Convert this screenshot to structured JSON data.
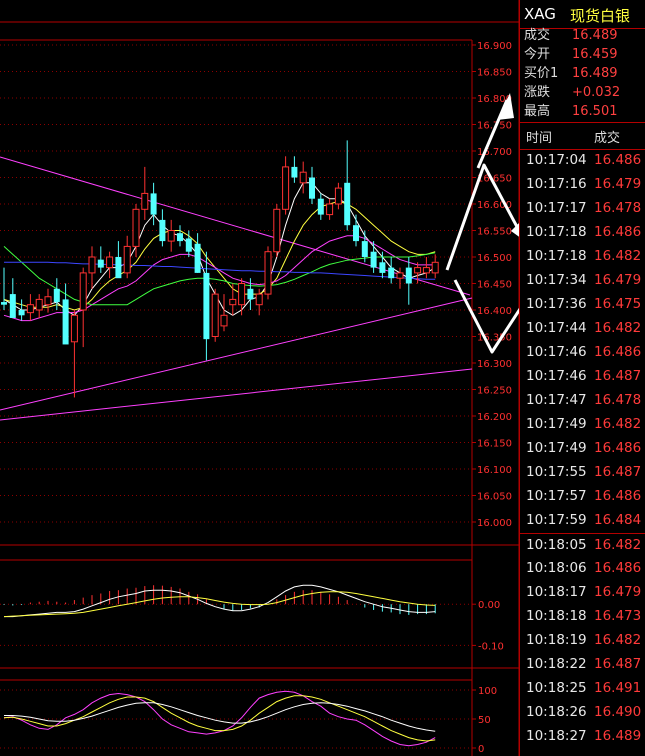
{
  "header": {
    "symbol": "XAG",
    "name": "现货白银"
  },
  "quote": [
    {
      "label": "成交",
      "value": "16.489"
    },
    {
      "label": "今开",
      "value": "16.459"
    },
    {
      "label": "买价1",
      "value": "16.489"
    },
    {
      "label": "涨跌",
      "value": "+0.032"
    },
    {
      "label": "最高",
      "value": "16.501"
    }
  ],
  "ticks_header": {
    "time": "时间",
    "price": "成交"
  },
  "ticks": [
    {
      "time": "10:17:04",
      "price": "16.486"
    },
    {
      "time": "10:17:16",
      "price": "16.479"
    },
    {
      "time": "10:17:17",
      "price": "16.478"
    },
    {
      "time": "10:17:18",
      "price": "16.486"
    },
    {
      "time": "10:17:18",
      "price": "16.482"
    },
    {
      "time": "10:17:34",
      "price": "16.479"
    },
    {
      "time": "10:17:36",
      "price": "16.475"
    },
    {
      "time": "10:17:44",
      "price": "16.482"
    },
    {
      "time": "10:17:46",
      "price": "16.486"
    },
    {
      "time": "10:17:46",
      "price": "16.487"
    },
    {
      "time": "10:17:47",
      "price": "16.478"
    },
    {
      "time": "10:17:49",
      "price": "16.482"
    },
    {
      "time": "10:17:49",
      "price": "16.486"
    },
    {
      "time": "10:17:55",
      "price": "16.487"
    },
    {
      "time": "10:17:57",
      "price": "16.486"
    },
    {
      "time": "10:17:59",
      "price": "16.484"
    },
    {
      "time": "10:18:05",
      "price": "16.482"
    },
    {
      "time": "10:18:06",
      "price": "16.486"
    },
    {
      "time": "10:18:17",
      "price": "16.479"
    },
    {
      "time": "10:18:18",
      "price": "16.473"
    },
    {
      "time": "10:18:19",
      "price": "16.482"
    },
    {
      "time": "10:18:22",
      "price": "16.487"
    },
    {
      "time": "10:18:25",
      "price": "16.491"
    },
    {
      "time": "10:18:26",
      "price": "16.490"
    },
    {
      "time": "10:18:27",
      "price": "16.489"
    }
  ],
  "colors": {
    "up": "#ff3232",
    "down": "#54ffff",
    "grid": "#8c0000",
    "frame": "#b40000"
  },
  "chart_data": [
    {
      "type": "candlestick",
      "ylim": [
        16.0,
        16.9
      ],
      "y_ticks": [
        "16.900",
        "16.850",
        "16.800",
        "16.750",
        "16.700",
        "16.650",
        "16.600",
        "16.550",
        "16.500",
        "16.450",
        "16.400",
        "16.350",
        "16.300",
        "16.250",
        "16.200",
        "16.150",
        "16.100",
        "16.050",
        "16.000"
      ],
      "candles": [
        {
          "o": 16.415,
          "h": 16.48,
          "l": 16.4,
          "c": 16.41
        },
        {
          "o": 16.43,
          "h": 16.46,
          "l": 16.395,
          "c": 16.385
        },
        {
          "o": 16.4,
          "h": 16.42,
          "l": 16.38,
          "c": 16.39
        },
        {
          "o": 16.395,
          "h": 16.43,
          "l": 16.38,
          "c": 16.41
        },
        {
          "o": 16.4,
          "h": 16.43,
          "l": 16.385,
          "c": 16.42
        },
        {
          "o": 16.41,
          "h": 16.44,
          "l": 16.395,
          "c": 16.425
        },
        {
          "o": 16.44,
          "h": 16.46,
          "l": 16.4,
          "c": 16.415
        },
        {
          "o": 16.42,
          "h": 16.45,
          "l": 16.34,
          "c": 16.335
        },
        {
          "o": 16.34,
          "h": 16.4,
          "l": 16.235,
          "c": 16.39
        },
        {
          "o": 16.4,
          "h": 16.48,
          "l": 16.33,
          "c": 16.47
        },
        {
          "o": 16.47,
          "h": 16.52,
          "l": 16.44,
          "c": 16.5
        },
        {
          "o": 16.495,
          "h": 16.52,
          "l": 16.47,
          "c": 16.48
        },
        {
          "o": 16.48,
          "h": 16.51,
          "l": 16.46,
          "c": 16.5
        },
        {
          "o": 16.5,
          "h": 16.53,
          "l": 16.47,
          "c": 16.46
        },
        {
          "o": 16.47,
          "h": 16.54,
          "l": 16.46,
          "c": 16.52
        },
        {
          "o": 16.52,
          "h": 16.6,
          "l": 16.5,
          "c": 16.59
        },
        {
          "o": 16.59,
          "h": 16.67,
          "l": 16.57,
          "c": 16.62
        },
        {
          "o": 16.62,
          "h": 16.64,
          "l": 16.56,
          "c": 16.58
        },
        {
          "o": 16.57,
          "h": 16.59,
          "l": 16.52,
          "c": 16.53
        },
        {
          "o": 16.53,
          "h": 16.57,
          "l": 16.51,
          "c": 16.55
        },
        {
          "o": 16.545,
          "h": 16.56,
          "l": 16.52,
          "c": 16.53
        },
        {
          "o": 16.535,
          "h": 16.55,
          "l": 16.5,
          "c": 16.51
        },
        {
          "o": 16.525,
          "h": 16.545,
          "l": 16.47,
          "c": 16.47
        },
        {
          "o": 16.47,
          "h": 16.51,
          "l": 16.305,
          "c": 16.345
        },
        {
          "o": 16.35,
          "h": 16.44,
          "l": 16.34,
          "c": 16.43
        },
        {
          "o": 16.37,
          "h": 16.43,
          "l": 16.36,
          "c": 16.39
        },
        {
          "o": 16.41,
          "h": 16.45,
          "l": 16.39,
          "c": 16.42
        },
        {
          "o": 16.41,
          "h": 16.46,
          "l": 16.39,
          "c": 16.45
        },
        {
          "o": 16.44,
          "h": 16.46,
          "l": 16.4,
          "c": 16.42
        },
        {
          "o": 16.41,
          "h": 16.44,
          "l": 16.39,
          "c": 16.43
        },
        {
          "o": 16.43,
          "h": 16.52,
          "l": 16.42,
          "c": 16.51
        },
        {
          "o": 16.51,
          "h": 16.6,
          "l": 16.5,
          "c": 16.59
        },
        {
          "o": 16.59,
          "h": 16.69,
          "l": 16.58,
          "c": 16.67
        },
        {
          "o": 16.67,
          "h": 16.69,
          "l": 16.64,
          "c": 16.65
        },
        {
          "o": 16.64,
          "h": 16.68,
          "l": 16.62,
          "c": 16.66
        },
        {
          "o": 16.65,
          "h": 16.67,
          "l": 16.6,
          "c": 16.61
        },
        {
          "o": 16.61,
          "h": 16.62,
          "l": 16.57,
          "c": 16.58
        },
        {
          "o": 16.58,
          "h": 16.61,
          "l": 16.57,
          "c": 16.6
        },
        {
          "o": 16.6,
          "h": 16.64,
          "l": 16.59,
          "c": 16.63
        },
        {
          "o": 16.64,
          "h": 16.72,
          "l": 16.55,
          "c": 16.56
        },
        {
          "o": 16.56,
          "h": 16.58,
          "l": 16.52,
          "c": 16.53
        },
        {
          "o": 16.53,
          "h": 16.55,
          "l": 16.49,
          "c": 16.5
        },
        {
          "o": 16.51,
          "h": 16.53,
          "l": 16.47,
          "c": 16.48
        },
        {
          "o": 16.49,
          "h": 16.51,
          "l": 16.46,
          "c": 16.47
        },
        {
          "o": 16.48,
          "h": 16.5,
          "l": 16.45,
          "c": 16.46
        },
        {
          "o": 16.46,
          "h": 16.48,
          "l": 16.44,
          "c": 16.47
        },
        {
          "o": 16.48,
          "h": 16.5,
          "l": 16.41,
          "c": 16.45
        },
        {
          "o": 16.47,
          "h": 16.49,
          "l": 16.45,
          "c": 16.48
        },
        {
          "o": 16.47,
          "h": 16.5,
          "l": 16.46,
          "c": 16.48
        },
        {
          "o": 16.47,
          "h": 16.505,
          "l": 16.46,
          "c": 16.49
        }
      ],
      "ma_lines": [
        {
          "color": "#ffffff",
          "values": [
            16.42,
            16.41,
            16.4,
            16.4,
            16.405,
            16.41,
            16.415,
            16.4,
            16.39,
            16.41,
            16.44,
            16.46,
            16.48,
            16.48,
            16.49,
            16.52,
            16.56,
            16.58,
            16.56,
            16.545,
            16.54,
            16.525,
            16.505,
            16.46,
            16.43,
            16.4,
            16.39,
            16.4,
            16.42,
            16.425,
            16.45,
            16.5,
            16.56,
            16.61,
            16.64,
            16.64,
            16.62,
            16.61,
            16.61,
            16.6,
            16.57,
            16.54,
            16.52,
            16.5,
            16.48,
            16.47,
            16.46,
            16.465,
            16.47,
            16.48
          ]
        },
        {
          "color": "#ffff40",
          "values": [
            16.42,
            16.415,
            16.41,
            16.405,
            16.405,
            16.405,
            16.41,
            16.405,
            16.4,
            16.405,
            16.42,
            16.44,
            16.455,
            16.465,
            16.475,
            16.49,
            16.515,
            16.535,
            16.545,
            16.55,
            16.55,
            16.54,
            16.525,
            16.5,
            16.48,
            16.46,
            16.44,
            16.43,
            16.43,
            16.43,
            16.44,
            16.46,
            16.495,
            16.53,
            16.56,
            16.58,
            16.595,
            16.6,
            16.605,
            16.6,
            16.59,
            16.575,
            16.56,
            16.545,
            16.53,
            16.52,
            16.51,
            16.505,
            16.505,
            16.51
          ]
        },
        {
          "color": "#ff40ff",
          "values": [
            16.39,
            16.385,
            16.38,
            16.38,
            16.385,
            16.39,
            16.395,
            16.395,
            16.395,
            16.4,
            16.41,
            16.42,
            16.43,
            16.44,
            16.445,
            16.455,
            16.47,
            16.485,
            16.495,
            16.5,
            16.505,
            16.505,
            16.5,
            16.49,
            16.48,
            16.47,
            16.46,
            16.455,
            16.45,
            16.448,
            16.45,
            16.455,
            16.465,
            16.48,
            16.495,
            16.51,
            16.52,
            16.53,
            16.535,
            16.54,
            16.54,
            16.535,
            16.525,
            16.515,
            16.505,
            16.495,
            16.49,
            16.485,
            16.485,
            16.485
          ]
        },
        {
          "color": "#40ff40",
          "values": [
            16.52,
            16.505,
            16.49,
            16.475,
            16.46,
            16.45,
            16.44,
            16.43,
            16.42,
            16.415,
            16.41,
            16.41,
            16.41,
            16.41,
            16.41,
            16.42,
            16.43,
            16.44,
            16.445,
            16.45,
            16.455,
            16.458,
            16.46,
            16.46,
            16.458,
            16.455,
            16.45,
            16.448,
            16.446,
            16.445,
            16.446,
            16.448,
            16.452,
            16.458,
            16.465,
            16.472,
            16.48,
            16.486,
            16.49,
            16.494,
            16.496,
            16.498,
            16.5,
            16.5,
            16.5,
            16.5,
            16.5,
            16.502,
            16.505,
            16.508
          ]
        },
        {
          "color": "#3c46ff",
          "values": [
            16.49,
            16.49,
            16.49,
            16.49,
            16.49,
            16.49,
            16.489,
            16.489,
            16.488,
            16.487,
            16.487,
            16.486,
            16.486,
            16.485,
            16.485,
            16.484,
            16.484,
            16.483,
            16.482,
            16.482,
            16.481,
            16.48,
            16.479,
            16.478,
            16.477,
            16.476,
            16.475,
            16.474,
            16.474,
            16.473,
            16.473,
            16.472,
            16.472,
            16.471,
            16.471,
            16.47,
            16.47,
            16.469,
            16.468,
            16.467,
            16.466,
            16.465,
            16.464,
            16.463,
            16.462,
            16.461,
            16.46,
            16.459,
            16.458,
            16.458
          ]
        }
      ]
    },
    {
      "type": "bar",
      "y_ticks": [
        "0.00",
        "-0.10"
      ],
      "ylim": [
        -0.15,
        0.1
      ],
      "values": [
        -0.002,
        -0.003,
        -0.002,
        0.004,
        0.006,
        0.008,
        0.006,
        0.004,
        0.01,
        0.016,
        0.022,
        0.026,
        0.032,
        0.034,
        0.038,
        0.04,
        0.044,
        0.046,
        0.045,
        0.042,
        0.038,
        0.03,
        0.024,
        0.012,
        0.0,
        -0.012,
        -0.016,
        -0.014,
        -0.01,
        -0.008,
        0.0,
        0.012,
        0.022,
        0.03,
        0.034,
        0.034,
        0.03,
        0.024,
        0.018,
        0.01,
        0.0,
        -0.008,
        -0.014,
        -0.018,
        -0.02,
        -0.024,
        -0.026,
        -0.024,
        -0.024,
        -0.022
      ],
      "dif": [
        -0.03,
        -0.03,
        -0.028,
        -0.026,
        -0.024,
        -0.022,
        -0.02,
        -0.02,
        -0.018,
        -0.012,
        -0.004,
        0.004,
        0.012,
        0.018,
        0.022,
        0.026,
        0.032,
        0.034,
        0.034,
        0.032,
        0.028,
        0.02,
        0.012,
        0.002,
        -0.006,
        -0.012,
        -0.016,
        -0.016,
        -0.012,
        -0.006,
        0.004,
        0.018,
        0.032,
        0.042,
        0.046,
        0.046,
        0.042,
        0.036,
        0.03,
        0.022,
        0.014,
        0.006,
        0.0,
        -0.006,
        -0.01,
        -0.014,
        -0.018,
        -0.02,
        -0.02,
        -0.018
      ],
      "dea": [
        -0.03,
        -0.029,
        -0.028,
        -0.027,
        -0.026,
        -0.025,
        -0.024,
        -0.023,
        -0.022,
        -0.02,
        -0.016,
        -0.012,
        -0.008,
        -0.004,
        0.0,
        0.004,
        0.008,
        0.012,
        0.015,
        0.017,
        0.018,
        0.018,
        0.016,
        0.013,
        0.009,
        0.005,
        0.002,
        0.0,
        -0.001,
        -0.001,
        0.0,
        0.004,
        0.01,
        0.016,
        0.022,
        0.026,
        0.029,
        0.03,
        0.03,
        0.029,
        0.026,
        0.022,
        0.018,
        0.014,
        0.01,
        0.006,
        0.003,
        0.0,
        -0.002,
        -0.003
      ],
      "dif_color": "#ffffff",
      "dea_color": "#ffff40"
    },
    {
      "type": "line",
      "y_ticks": [
        "100",
        "50",
        "0"
      ],
      "ylim": [
        0,
        100
      ],
      "series": [
        {
          "color": "#ff40ff",
          "values": [
            52,
            54,
            48,
            40,
            34,
            32,
            40,
            52,
            58,
            66,
            78,
            86,
            92,
            94,
            92,
            88,
            80,
            66,
            50,
            40,
            34,
            28,
            26,
            24,
            26,
            30,
            38,
            52,
            70,
            86,
            92,
            96,
            98,
            96,
            90,
            80,
            72,
            60,
            54,
            50,
            48,
            40,
            30,
            20,
            12,
            6,
            4,
            6,
            10,
            18
          ]
        },
        {
          "color": "#ffff40",
          "values": [
            52,
            53,
            50,
            46,
            42,
            38,
            38,
            42,
            48,
            54,
            62,
            70,
            78,
            84,
            88,
            88,
            86,
            80,
            70,
            60,
            52,
            44,
            38,
            34,
            30,
            30,
            32,
            38,
            48,
            60,
            70,
            80,
            86,
            90,
            90,
            88,
            84,
            78,
            72,
            66,
            60,
            54,
            46,
            38,
            30,
            24,
            18,
            14,
            12,
            14
          ]
        },
        {
          "color": "#ffffff",
          "values": [
            56,
            56,
            55,
            53,
            50,
            47,
            46,
            46,
            48,
            51,
            55,
            60,
            65,
            70,
            74,
            77,
            78,
            78,
            75,
            71,
            66,
            61,
            56,
            52,
            48,
            45,
            43,
            43,
            45,
            49,
            54,
            60,
            66,
            71,
            75,
            77,
            78,
            77,
            75,
            72,
            68,
            64,
            59,
            54,
            48,
            43,
            38,
            34,
            31,
            29
          ]
        }
      ]
    }
  ]
}
